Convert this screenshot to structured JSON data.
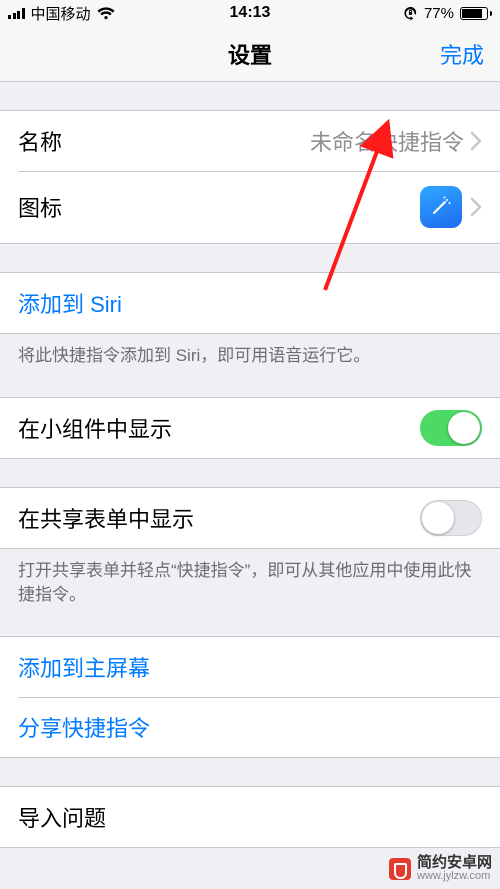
{
  "status": {
    "carrier": "中国移动",
    "time": "14:13",
    "battery_pct": "77%"
  },
  "nav": {
    "title": "设置",
    "done": "完成"
  },
  "group1": {
    "name_label": "名称",
    "name_value": "未命名快捷指令",
    "icon_label": "图标"
  },
  "group2": {
    "add_siri": "添加到 Siri",
    "siri_hint": "将此快捷指令添加到 Siri，即可用语音运行它。"
  },
  "group3": {
    "widget_label": "在小组件中显示"
  },
  "group4": {
    "share_sheet_label": "在共享表单中显示",
    "share_sheet_hint": "打开共享表单并轻点“快捷指令”，即可从其他应用中使用此快捷指令。"
  },
  "group5": {
    "add_home": "添加到主屏幕",
    "share_shortcut": "分享快捷指令"
  },
  "group6": {
    "import_label": "导入问题"
  },
  "watermark": {
    "title": "简约安卓网",
    "url": "www.jylzw.com"
  }
}
